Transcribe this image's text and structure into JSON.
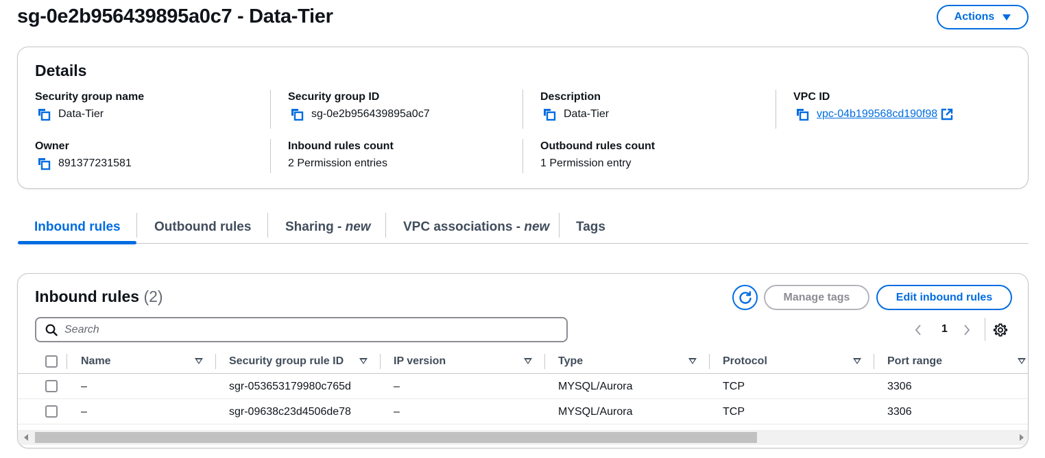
{
  "header": {
    "title": "sg-0e2b956439895a0c7 - Data-Tier",
    "actions_label": "Actions"
  },
  "details": {
    "title": "Details",
    "fields": {
      "sg_name": {
        "label": "Security group name",
        "value": "Data-Tier"
      },
      "sg_id": {
        "label": "Security group ID",
        "value": "sg-0e2b956439895a0c7"
      },
      "description": {
        "label": "Description",
        "value": "Data-Tier"
      },
      "vpc_id": {
        "label": "VPC ID",
        "value": "vpc-04b199568cd190f98"
      },
      "owner": {
        "label": "Owner",
        "value": "891377231581"
      },
      "inbound_count": {
        "label": "Inbound rules count",
        "value": "2 Permission entries"
      },
      "outbound_count": {
        "label": "Outbound rules count",
        "value": "1 Permission entry"
      }
    }
  },
  "tabs": {
    "inbound": "Inbound rules",
    "outbound": "Outbound rules",
    "sharing": "Sharing - ",
    "sharing_badge": "new",
    "vpc_assoc": "VPC associations - ",
    "vpc_assoc_badge": "new",
    "tags": "Tags"
  },
  "inbound_rules": {
    "title": "Inbound rules",
    "count": "(2)",
    "manage_tags_label": "Manage tags",
    "edit_label": "Edit inbound rules",
    "search_placeholder": "Search",
    "page": "1",
    "columns": {
      "name": "Name",
      "rule_id": "Security group rule ID",
      "ip_version": "IP version",
      "type": "Type",
      "protocol": "Protocol",
      "port_range": "Port range"
    },
    "rows": [
      {
        "name": "–",
        "rule_id": "sgr-053653179980c765d",
        "ip_version": "–",
        "type": "MYSQL/Aurora",
        "protocol": "TCP",
        "port_range": "3306"
      },
      {
        "name": "–",
        "rule_id": "sgr-09638c23d4506de78",
        "ip_version": "–",
        "type": "MYSQL/Aurora",
        "protocol": "TCP",
        "port_range": "3306"
      }
    ]
  },
  "colors": {
    "accent": "#006ce0",
    "text": "#0f141a",
    "border": "#c6c6cd"
  }
}
